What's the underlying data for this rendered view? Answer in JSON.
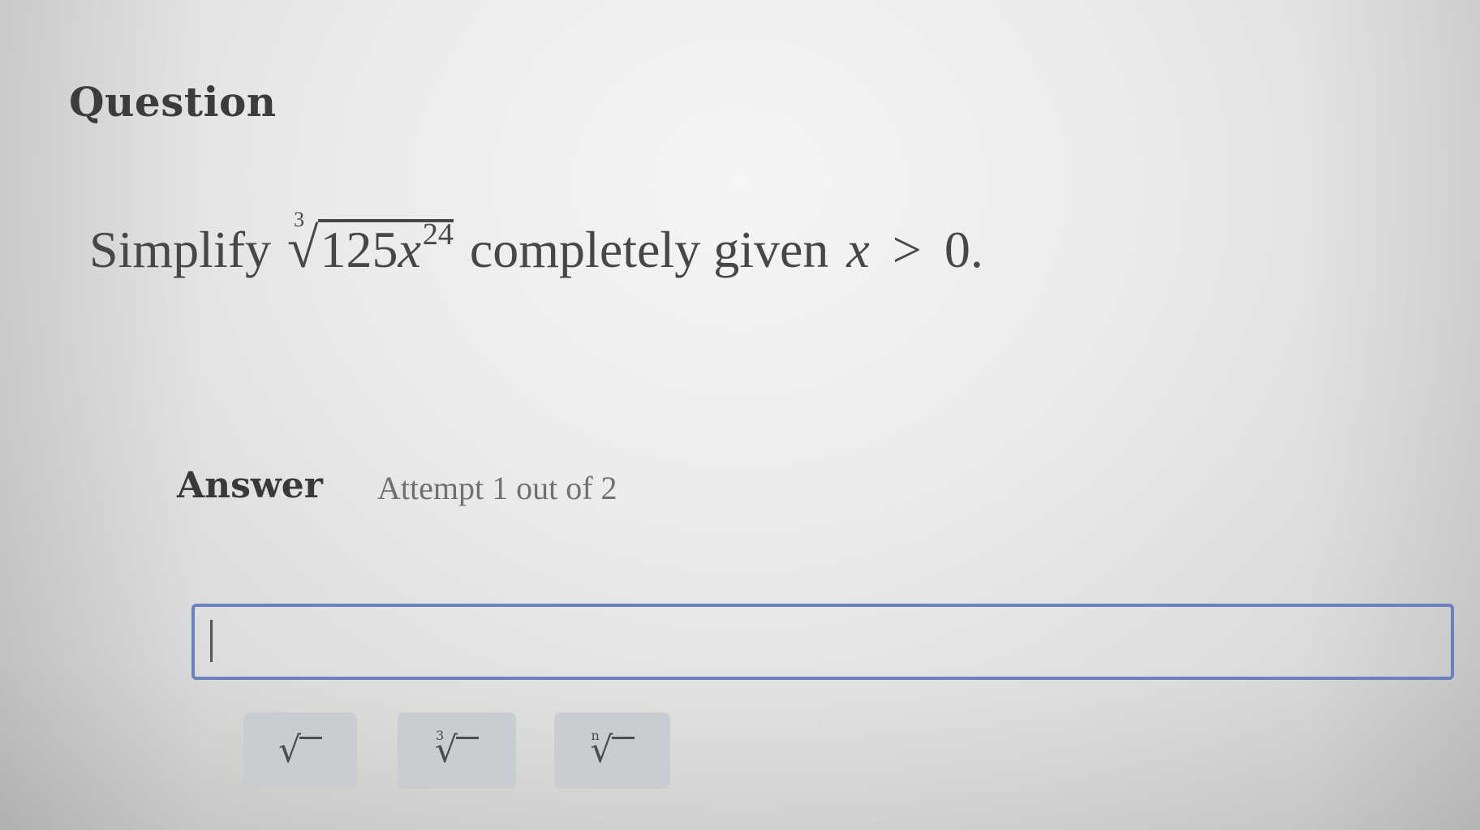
{
  "question": {
    "heading": "Question",
    "prompt_prefix": "Simplify",
    "radical_index": "3",
    "radicand_coefficient": "125",
    "radicand_variable": "x",
    "radicand_exponent": "24",
    "prompt_suffix": "completely given",
    "condition_variable": "x",
    "condition_operator": ">",
    "condition_value": "0."
  },
  "answer": {
    "heading": "Answer",
    "attempt_text": "Attempt 1 out of 2",
    "input_value": ""
  },
  "math_buttons": [
    {
      "icon": "square-root-icon",
      "index": ""
    },
    {
      "icon": "cube-root-icon",
      "index": "3"
    },
    {
      "icon": "nth-root-icon",
      "index": "n"
    }
  ],
  "colors": {
    "input_border": "#6a80bf",
    "button_background": "#c9ccd0",
    "text": "#474747"
  }
}
